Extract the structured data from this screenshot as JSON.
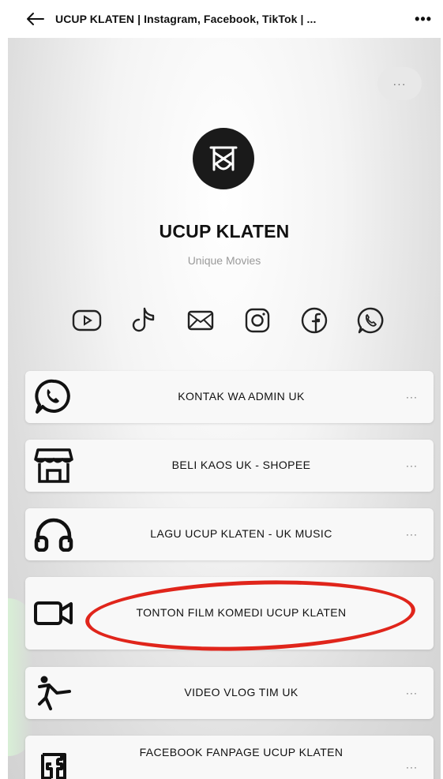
{
  "header": {
    "title": "UCUP KLATEN | Instagram, Facebook, TikTok | ...",
    "more_label": "•••"
  },
  "share_label": "···",
  "profile": {
    "name": "UCUP KLATEN",
    "bio": "Unique Movies"
  },
  "socials": [
    "youtube-icon",
    "tiktok-icon",
    "email-icon",
    "instagram-icon",
    "facebook-icon",
    "whatsapp-icon"
  ],
  "links": [
    {
      "label": "KONTAK WA ADMIN UK",
      "icon": "whatsapp-icon",
      "menu": "···"
    },
    {
      "label": "BELI KAOS UK - SHOPEE",
      "icon": "store-icon",
      "menu": "···"
    },
    {
      "label": "LAGU UCUP KLATEN - UK MUSIC",
      "icon": "headphones-icon",
      "menu": "···"
    },
    {
      "label": "TONTON FILM KOMEDI UCUP KLATEN",
      "icon": "video-camera-icon",
      "menu": ""
    },
    {
      "label": "VIDEO VLOG TIM UK",
      "icon": "person-kick-icon",
      "menu": "···"
    },
    {
      "label": "FACEBOOK FANPAGE UCUP KLATEN",
      "icon": "facebook-icon",
      "menu": "···"
    }
  ],
  "colors": {
    "highlight": "#e0251b",
    "avatar_bg": "#1a1a1a"
  }
}
